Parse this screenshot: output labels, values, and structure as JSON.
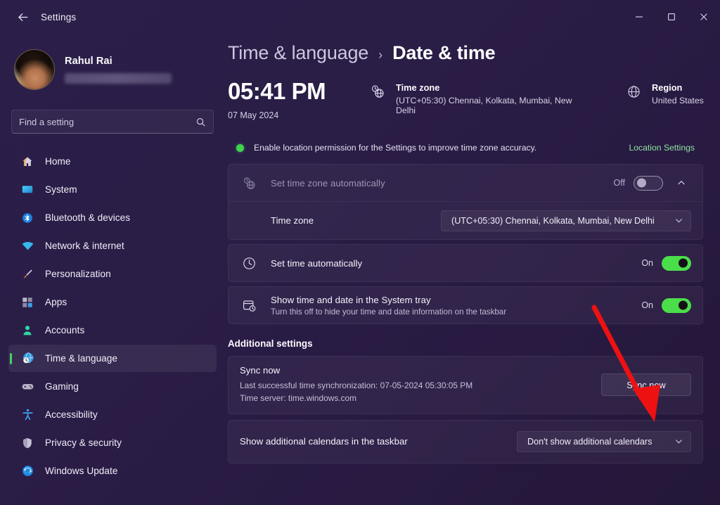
{
  "window": {
    "title": "Settings",
    "back_icon": "back-arrow-icon",
    "controls": {
      "minimize": "–",
      "maximize": "□",
      "close": "✕"
    }
  },
  "sidebar": {
    "profile": {
      "name": "Rahul Rai",
      "email_masked": ""
    },
    "search": {
      "placeholder": "Find a setting",
      "value": "",
      "icon": "search-icon"
    },
    "items": [
      {
        "label": "Home",
        "icon": "home-icon",
        "active": false
      },
      {
        "label": "System",
        "icon": "system-icon",
        "active": false
      },
      {
        "label": "Bluetooth & devices",
        "icon": "bluetooth-icon",
        "active": false
      },
      {
        "label": "Network & internet",
        "icon": "wifi-icon",
        "active": false
      },
      {
        "label": "Personalization",
        "icon": "paintbrush-icon",
        "active": false
      },
      {
        "label": "Apps",
        "icon": "apps-icon",
        "active": false
      },
      {
        "label": "Accounts",
        "icon": "person-icon",
        "active": false
      },
      {
        "label": "Time & language",
        "icon": "clock-globe-icon",
        "active": true
      },
      {
        "label": "Gaming",
        "icon": "gamepad-icon",
        "active": false
      },
      {
        "label": "Accessibility",
        "icon": "accessibility-icon",
        "active": false
      },
      {
        "label": "Privacy & security",
        "icon": "shield-icon",
        "active": false
      },
      {
        "label": "Windows Update",
        "icon": "update-icon",
        "active": false
      }
    ]
  },
  "main": {
    "breadcrumb": {
      "parent": "Time & language",
      "separator": "›",
      "current": "Date & time"
    },
    "summary": {
      "time": "05:41 PM",
      "date": "07 May 2024",
      "timezone": {
        "icon": "clock-globe-icon",
        "title": "Time zone",
        "value": "(UTC+05:30) Chennai, Kolkata, Mumbai, New Delhi"
      },
      "region": {
        "icon": "globe-icon",
        "title": "Region",
        "value": "United States"
      }
    },
    "banner": {
      "dot_color": "#3fd44f",
      "text": "Enable location permission for the Settings to improve time zone accuracy.",
      "link": "Location Settings"
    },
    "auto_timezone": {
      "icon": "clock-globe-icon",
      "title": "Set time zone automatically",
      "state_label": "Off",
      "state": "off",
      "expanded": true,
      "expand_icon": "chevron-up-icon",
      "sub": {
        "label": "Time zone",
        "value": "(UTC+05:30) Chennai, Kolkata, Mumbai, New Delhi",
        "chevron": "chevron-down-icon"
      }
    },
    "auto_time": {
      "icon": "clock-icon",
      "title": "Set time automatically",
      "state_label": "On",
      "state": "on"
    },
    "system_tray": {
      "icon": "calendar-clock-icon",
      "title": "Show time and date in the System tray",
      "subtitle": "Turn this off to hide your time and date information on the taskbar",
      "state_label": "On",
      "state": "on"
    },
    "additional_settings_heading": "Additional settings",
    "sync": {
      "title": "Sync now",
      "last_sync": "Last successful time synchronization: 07-05-2024 05:30:05 PM",
      "time_server": "Time server: time.windows.com",
      "button_label": "Sync now"
    },
    "calendars": {
      "label": "Show additional calendars in the taskbar",
      "value": "Don't show additional calendars",
      "chevron": "chevron-down-icon"
    }
  },
  "annotation": {
    "arrow_color": "#ee1111",
    "target": "sync-now-button"
  },
  "colors": {
    "accent_green": "#4ade4a",
    "nav_active_bar": "#46d160",
    "link_green": "#8ee0a0",
    "window_bg": "#2a1d46"
  }
}
